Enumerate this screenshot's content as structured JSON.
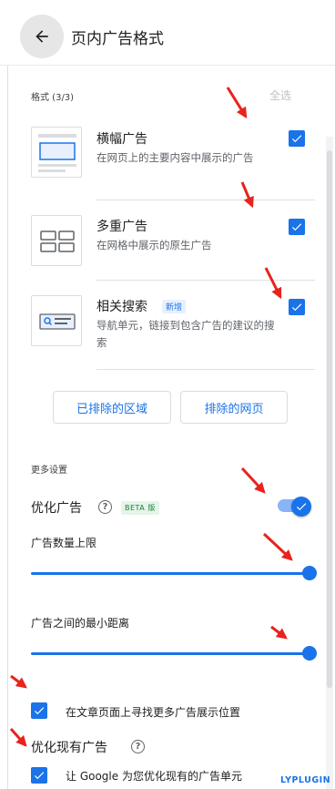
{
  "header": {
    "title": "页内广告格式"
  },
  "formats": {
    "label": "格式 (3/3)",
    "select_all": "全选",
    "items": [
      {
        "title": "横幅广告",
        "desc": "在网页上的主要内容中展示的广告",
        "checked": true
      },
      {
        "title": "多重广告",
        "desc": "在网格中展示的原生广告",
        "checked": true
      },
      {
        "title": "相关搜索",
        "badge": "新增",
        "desc": "导航单元，链接到包含广告的建议的搜索",
        "checked": true
      }
    ]
  },
  "buttons": {
    "excluded_areas": "已排除的区域",
    "excluded_pages": "排除的网页"
  },
  "more_settings": {
    "label": "更多设置",
    "optimize_ads": {
      "label": "优化广告",
      "beta": "BETA 版",
      "enabled": true
    },
    "ad_count_limit": {
      "label": "广告数量上限",
      "value_fraction": 1.0
    },
    "min_distance": {
      "label": "广告之间的最小距离",
      "value_fraction": 1.0
    },
    "find_more_positions": {
      "label": "在文章页面上寻找更多广告展示位置",
      "checked": true
    }
  },
  "optimize_existing": {
    "label": "优化现有广告",
    "google_optimize": {
      "label": "让 Google 为您优化现有的广告单元",
      "checked": true
    }
  },
  "watermark": "LYPLUGIN",
  "colors": {
    "accent": "#1a73e8",
    "arrow": "#e8231d",
    "beta": "#188038"
  }
}
